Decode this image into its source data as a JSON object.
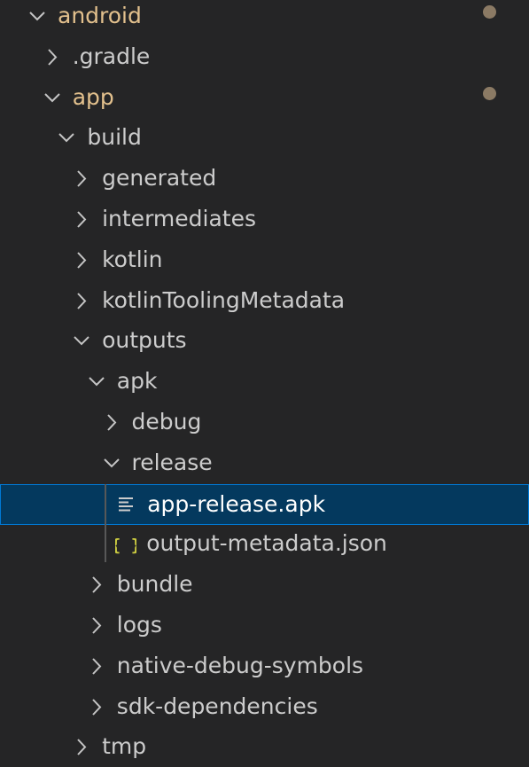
{
  "explorer": {
    "items": [
      {
        "label": "android",
        "depth": 0,
        "kind": "folder",
        "state": "expanded",
        "modified": true
      },
      {
        "label": ".gradle",
        "depth": 1,
        "kind": "folder",
        "state": "collapsed",
        "modified": false
      },
      {
        "label": "app",
        "depth": 1,
        "kind": "folder",
        "state": "expanded",
        "modified": true
      },
      {
        "label": "build",
        "depth": 2,
        "kind": "folder",
        "state": "expanded",
        "modified": false
      },
      {
        "label": "generated",
        "depth": 3,
        "kind": "folder",
        "state": "collapsed",
        "modified": false
      },
      {
        "label": "intermediates",
        "depth": 3,
        "kind": "folder",
        "state": "collapsed",
        "modified": false
      },
      {
        "label": "kotlin",
        "depth": 3,
        "kind": "folder",
        "state": "collapsed",
        "modified": false
      },
      {
        "label": "kotlinToolingMetadata",
        "depth": 3,
        "kind": "folder",
        "state": "collapsed",
        "modified": false
      },
      {
        "label": "outputs",
        "depth": 3,
        "kind": "folder",
        "state": "expanded",
        "modified": false
      },
      {
        "label": "apk",
        "depth": 4,
        "kind": "folder",
        "state": "expanded",
        "modified": false
      },
      {
        "label": "debug",
        "depth": 5,
        "kind": "folder",
        "state": "collapsed",
        "modified": false
      },
      {
        "label": "release",
        "depth": 5,
        "kind": "folder",
        "state": "expanded",
        "modified": false
      },
      {
        "label": "app-release.apk",
        "depth": 6,
        "kind": "file",
        "icon": "lines-file-icon",
        "selected": true,
        "modified": false
      },
      {
        "label": "output-metadata.json",
        "depth": 6,
        "kind": "file",
        "icon": "json-braces-icon",
        "selected": false,
        "modified": false
      },
      {
        "label": "bundle",
        "depth": 4,
        "kind": "folder",
        "state": "collapsed",
        "modified": false
      },
      {
        "label": "logs",
        "depth": 4,
        "kind": "folder",
        "state": "collapsed",
        "modified": false
      },
      {
        "label": "native-debug-symbols",
        "depth": 4,
        "kind": "folder",
        "state": "collapsed",
        "modified": false
      },
      {
        "label": "sdk-dependencies",
        "depth": 4,
        "kind": "folder",
        "state": "collapsed",
        "modified": false
      },
      {
        "label": "tmp",
        "depth": 3,
        "kind": "folder",
        "state": "collapsed",
        "modified": false
      }
    ]
  },
  "colors": {
    "background": "#252526",
    "text": "#cccccc",
    "modified_text": "#e2c08d",
    "modified_dot": "#8b7a64",
    "selected_background": "#04395e",
    "selected_border": "#0078d4",
    "selected_text": "#ffffff",
    "json_icon": "#cbcb41",
    "chevron": "#c5c5c5"
  }
}
